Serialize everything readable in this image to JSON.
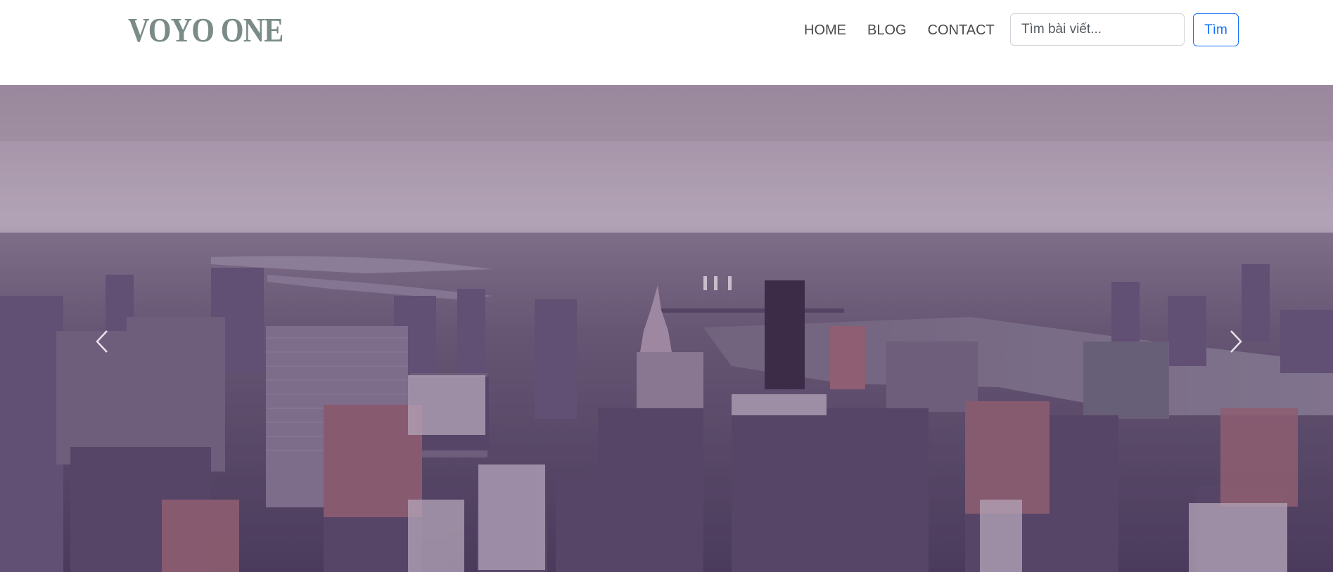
{
  "brand": {
    "logo_text": "VOYO ONE"
  },
  "nav": {
    "items": [
      {
        "label": "HOME"
      },
      {
        "label": "BLOG"
      },
      {
        "label": "CONTACT"
      }
    ]
  },
  "search": {
    "placeholder": "Tìm bài viết...",
    "value": "",
    "button_label": "Tìm"
  },
  "hero": {
    "image_description_icon": "city-skyline-photo",
    "controls": {
      "prev_icon": "chevron-left-icon",
      "next_icon": "chevron-right-icon"
    }
  },
  "colors": {
    "brand": "#7a8b88",
    "nav_text": "#4a4a4a",
    "primary": "#0d6efd",
    "hero_sky": "#a896ad",
    "hero_city": "#5a4866"
  }
}
